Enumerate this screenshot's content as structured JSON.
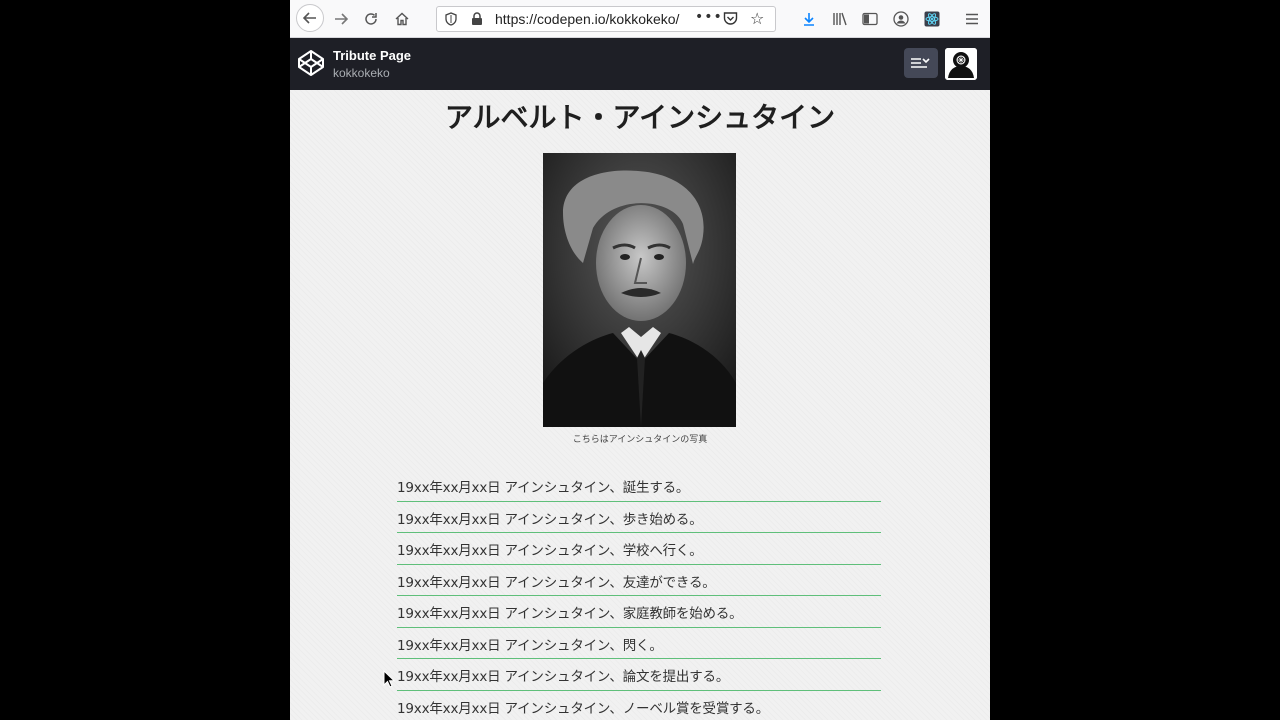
{
  "browser": {
    "url": "https://codepen.io/kokkokeko/"
  },
  "codepen": {
    "title": "Tribute Page",
    "user": "kokkokeko"
  },
  "page": {
    "title": "アルベルト・アインシュタイン",
    "caption": "こちらはアインシュタインの写真",
    "timeline": [
      "19xx年xx月xx日 アインシュタイン、誕生する。",
      "19xx年xx月xx日 アインシュタイン、歩き始める。",
      "19xx年xx月xx日 アインシュタイン、学校へ行く。",
      "19xx年xx月xx日 アインシュタイン、友達ができる。",
      "19xx年xx月xx日 アインシュタイン、家庭教師を始める。",
      "19xx年xx月xx日 アインシュタイン、閃く。",
      "19xx年xx月xx日 アインシュタイン、論文を提出する。",
      "19xx年xx月xx日 アインシュタイン、ノーベル賞を受賞する。"
    ]
  },
  "icons": {
    "back": "back-arrow-icon",
    "forward": "forward-arrow-icon",
    "reload": "reload-icon",
    "home": "home-icon",
    "download": "download-icon",
    "library": "library-icon",
    "sidebar": "sidebar-icon",
    "account": "account-icon",
    "extension": "react-extension-icon",
    "menu": "hamburger-menu-icon"
  },
  "colors": {
    "header_bg": "#1e1f26",
    "timeline_rule": "#5fbf7a",
    "download_accent": "#0a84ff"
  }
}
